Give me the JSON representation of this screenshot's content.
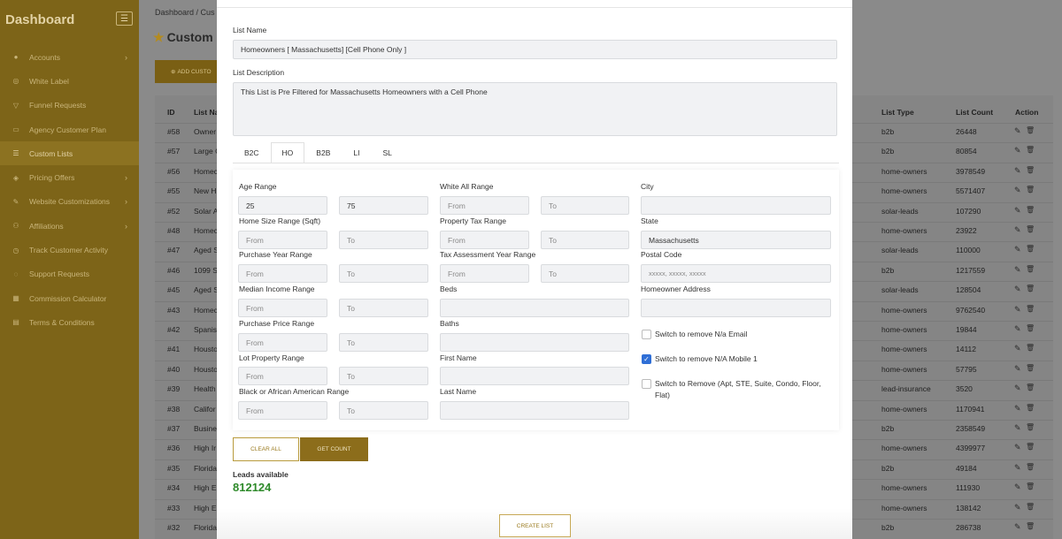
{
  "sidebar": {
    "brand": "Dashboard",
    "items": [
      {
        "label": "Accounts",
        "icon": "user-icon",
        "chev": "›"
      },
      {
        "label": "White Label",
        "icon": "globe-icon",
        "chev": ""
      },
      {
        "label": "Funnel Requests",
        "icon": "filter-icon",
        "chev": ""
      },
      {
        "label": "Agency Customer Plan",
        "icon": "card-icon",
        "chev": ""
      },
      {
        "label": "Custom Lists",
        "icon": "list-icon",
        "chev": ""
      },
      {
        "label": "Pricing Offers",
        "icon": "tag-icon",
        "chev": "›"
      },
      {
        "label": "Website Customizations",
        "icon": "brush-icon",
        "chev": "›"
      },
      {
        "label": "Affiliations",
        "icon": "people-icon",
        "chev": "›"
      },
      {
        "label": "Track Customer Activity",
        "icon": "clock-icon",
        "chev": ""
      },
      {
        "label": "Support Requests",
        "icon": "chat-icon",
        "chev": ""
      },
      {
        "label": "Commission Calculator",
        "icon": "calculator-icon",
        "chev": ""
      },
      {
        "label": "Terms & Conditions",
        "icon": "doc-icon",
        "chev": ""
      }
    ]
  },
  "main": {
    "breadcrumb": "Dashboard  /  Cus",
    "title": "Custom",
    "add_button": "ADD CUSTO"
  },
  "table": {
    "headers": {
      "id": "ID",
      "name": "List Na",
      "type": "List Type",
      "count": "List Count",
      "action": "Action"
    },
    "rows": [
      {
        "id": "#58",
        "name": "Owner",
        "type": "b2b",
        "count": "26448"
      },
      {
        "id": "#57",
        "name": "Large C",
        "type": "b2b",
        "count": "80854"
      },
      {
        "id": "#56",
        "name": "Homec",
        "type": "home-owners",
        "count": "3978549"
      },
      {
        "id": "#55",
        "name": "New H",
        "type": "home-owners",
        "count": "5571407"
      },
      {
        "id": "#52",
        "name": "Solar A",
        "type": "solar-leads",
        "count": "107290"
      },
      {
        "id": "#48",
        "name": "Homec",
        "type": "home-owners",
        "count": "23922"
      },
      {
        "id": "#47",
        "name": "Aged S",
        "type": "solar-leads",
        "count": "110000"
      },
      {
        "id": "#46",
        "name": "1099 S",
        "type": "b2b",
        "count": "1217559"
      },
      {
        "id": "#45",
        "name": "Aged S",
        "type": "solar-leads",
        "count": "128504"
      },
      {
        "id": "#43",
        "name": "Homec",
        "type": "home-owners",
        "count": "9762540"
      },
      {
        "id": "#42",
        "name": "Spanis",
        "type": "home-owners",
        "count": "19844"
      },
      {
        "id": "#41",
        "name": "Housto",
        "type": "home-owners",
        "count": "14112"
      },
      {
        "id": "#40",
        "name": "Housto",
        "type": "home-owners",
        "count": "57795"
      },
      {
        "id": "#39",
        "name": "Health",
        "type": "lead-insurance",
        "count": "3520"
      },
      {
        "id": "#38",
        "name": "Califor",
        "type": "home-owners",
        "count": "1170941"
      },
      {
        "id": "#37",
        "name": "Busine",
        "type": "b2b",
        "count": "2358549"
      },
      {
        "id": "#36",
        "name": "High Ir",
        "type": "home-owners",
        "count": "4399977"
      },
      {
        "id": "#35",
        "name": "Florida",
        "type": "b2b",
        "count": "49184"
      },
      {
        "id": "#34",
        "name": "High E",
        "type": "home-owners",
        "count": "111930"
      },
      {
        "id": "#33",
        "name": "High E",
        "type": "home-owners",
        "count": "138142"
      },
      {
        "id": "#32",
        "name": "Florida",
        "type": "b2b",
        "count": "286738"
      }
    ]
  },
  "modal": {
    "list_name_label": "List Name",
    "list_name_value": "Homeowners [ Massachusetts] [Cell Phone Only ]",
    "list_desc_label": "List Description",
    "list_desc_value": "This List is Pre Filtered for Massachusetts Homeowners with a Cell Phone",
    "tabs": [
      "B2C",
      "HO",
      "B2B",
      "LI",
      "SL"
    ],
    "active_tab": "HO",
    "fields": {
      "age_range": {
        "label": "Age Range",
        "from": "25",
        "to": "75"
      },
      "white_all_range": {
        "label": "White All Range",
        "from": "From",
        "to": "To"
      },
      "city": {
        "label": "City",
        "value": ""
      },
      "home_size_range": {
        "label": "Home Size Range (Sqft)",
        "from": "From",
        "to": "To"
      },
      "property_tax_range": {
        "label": "Property Tax Range",
        "from": "From",
        "to": "To"
      },
      "state": {
        "label": "State",
        "value": "Massachusetts"
      },
      "purchase_year_range": {
        "label": "Purchase Year Range",
        "from": "From",
        "to": "To"
      },
      "tax_assessment_year_range": {
        "label": "Tax Assessment Year Range",
        "from": "From",
        "to": "To"
      },
      "postal_code": {
        "label": "Postal Code",
        "placeholder": "xxxxx, xxxxx, xxxxx"
      },
      "median_income_range": {
        "label": "Median Income Range",
        "from": "From",
        "to": "To"
      },
      "beds": {
        "label": "Beds",
        "value": ""
      },
      "homeowner_address": {
        "label": "Homeowner Address",
        "value": ""
      },
      "purchase_price_range": {
        "label": "Purchase Price Range",
        "from": "From",
        "to": "To"
      },
      "baths": {
        "label": "Baths",
        "value": ""
      },
      "lot_property_range": {
        "label": "Lot Property Range",
        "from": "From",
        "to": "To"
      },
      "first_name": {
        "label": "First Name",
        "value": ""
      },
      "black_african_american_range": {
        "label": "Black or African American Range",
        "from": "From",
        "to": "To"
      },
      "last_name": {
        "label": "Last Name",
        "value": ""
      }
    },
    "checkboxes": [
      {
        "label": "Switch to remove N/a Email",
        "checked": false
      },
      {
        "label": "Switch to remove N/A Mobile 1",
        "checked": true
      },
      {
        "label": "Switch to Remove (Apt, STE, Suite, Condo, Floor, Flat)",
        "checked": false
      }
    ],
    "clear_all": "CLEAR ALL",
    "get_count": "GET COUNT",
    "leads_label": "Leads available",
    "leads_value": "812124",
    "create_list": "CREATE LIST"
  },
  "colors": {
    "sidebar": "#7d6418",
    "accent": "#8c6d1b",
    "leads_green": "#2e8a2a",
    "check_blue": "#2f6fd6"
  }
}
